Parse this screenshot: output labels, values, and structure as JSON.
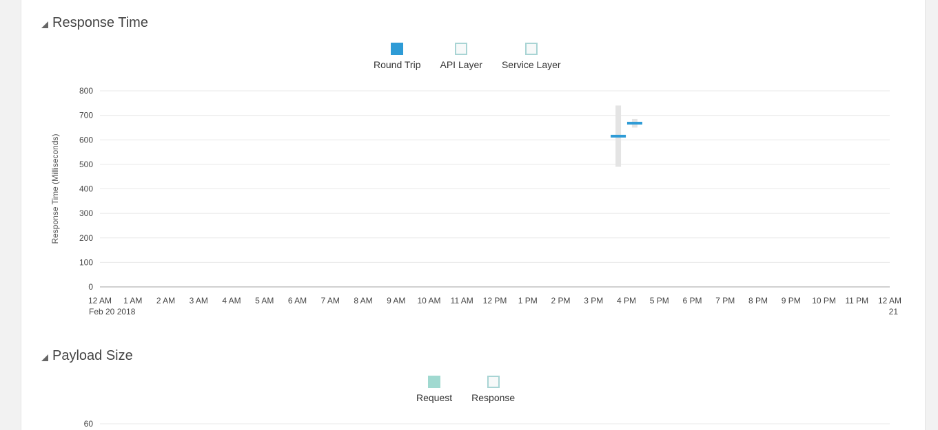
{
  "response_section": {
    "title": "Response Time",
    "legend": [
      {
        "label": "Round Trip",
        "color": "#2e9bd6",
        "filled": true
      },
      {
        "label": "API Layer",
        "color": "#a8d4d4",
        "filled": false
      },
      {
        "label": "Service Layer",
        "color": "#a8d4d4",
        "filled": false
      }
    ]
  },
  "payload_section": {
    "title": "Payload Size",
    "legend": [
      {
        "label": "Request",
        "color": "#a0d9d0",
        "filled": true
      },
      {
        "label": "Response",
        "color": "#a8d4d4",
        "filled": false
      }
    ],
    "first_tick": "60"
  },
  "chart_data": [
    {
      "type": "scatter",
      "title": "Response Time",
      "ylabel": "Response Time (Milliseconds)",
      "ylim": [
        0,
        800
      ],
      "yticks": [
        0,
        100,
        200,
        300,
        400,
        500,
        600,
        700,
        800
      ],
      "xticks": [
        "12 AM",
        "1 AM",
        "2 AM",
        "3 AM",
        "4 AM",
        "5 AM",
        "6 AM",
        "7 AM",
        "8 AM",
        "9 AM",
        "10 AM",
        "11 AM",
        "12 PM",
        "1 PM",
        "2 PM",
        "3 PM",
        "4 PM",
        "5 PM",
        "6 PM",
        "7 PM",
        "8 PM",
        "9 PM",
        "10 PM",
        "11 PM",
        "12 AM"
      ],
      "xticks_secondary": {
        "first": "Feb 20 2018",
        "last": "21"
      },
      "grid": true,
      "series": [
        {
          "name": "Round Trip",
          "color": "#2e9bd6",
          "points": [
            {
              "x_hour": 15.75,
              "y": 615,
              "range": [
                490,
                740
              ]
            },
            {
              "x_hour": 16.25,
              "y": 668,
              "range": [
                650,
                685
              ]
            }
          ]
        }
      ]
    }
  ]
}
